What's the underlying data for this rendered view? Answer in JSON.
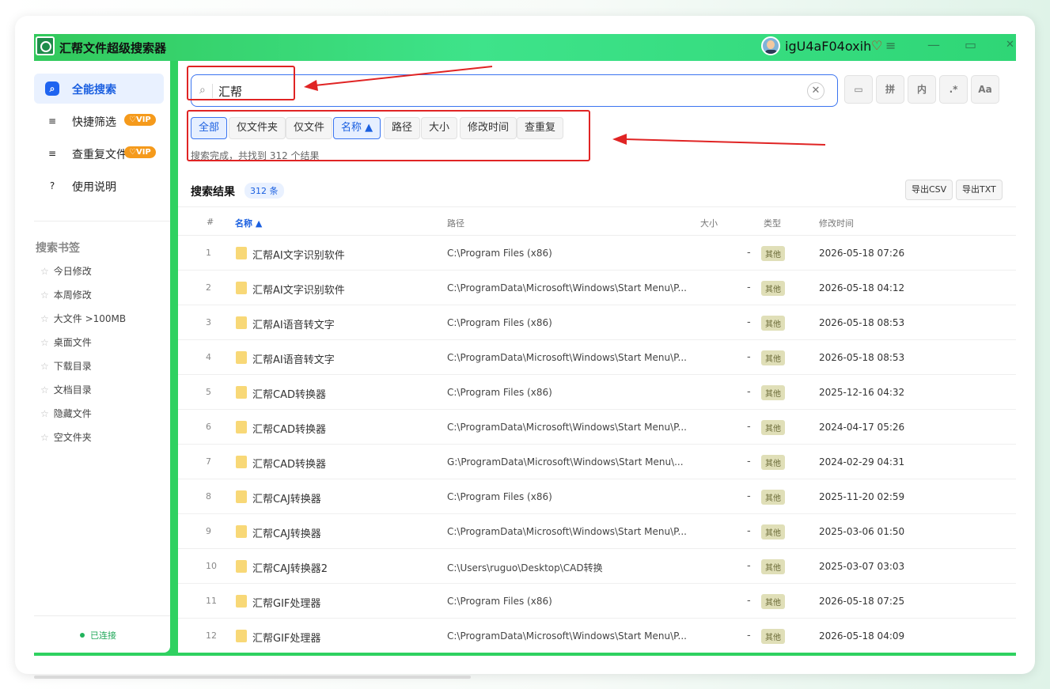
{
  "app": {
    "title": "汇帮文件超级搜索器",
    "username": "igU4aF04oxih",
    "heart": "♡",
    "menu": "≡",
    "minimize": "—",
    "maximize": "▭",
    "close": "✕"
  },
  "sidebar": {
    "nav": [
      {
        "icon": "⌕",
        "label": "全能搜索",
        "vip": ""
      },
      {
        "icon": "≡",
        "label": "快捷筛选",
        "vip": "♡VIP"
      },
      {
        "icon": "≡",
        "label": "查重复文件",
        "vip": "♡VIP"
      },
      {
        "icon": "?",
        "label": "使用说明",
        "vip": ""
      }
    ],
    "bookmarks_title": "搜索书签",
    "bookmarks": [
      "今日修改",
      "本周修改",
      "大文件 >100MB",
      "桌面文件",
      "下载目录",
      "文档目录",
      "隐藏文件",
      "空文件夹"
    ],
    "status": "已连接"
  },
  "search": {
    "icon": "⌕",
    "value": "汇帮",
    "clear": "✕"
  },
  "tools": [
    "▭",
    "拼",
    "内",
    ".*",
    "Aa"
  ],
  "filters": [
    "全部",
    "仅文件夹",
    "仅文件",
    "名称 ▲",
    "路径",
    "大小",
    "修改时间",
    "查重复"
  ],
  "status_text": "搜索完成，共找到 312 个结果",
  "results": {
    "title": "搜索结果",
    "count": "312 条",
    "export_csv": "导出CSV",
    "export_txt": "导出TXT",
    "columns": {
      "num": "#",
      "name": "名称 ▲",
      "path": "路径",
      "size": "大小",
      "type": "类型",
      "mtime": "修改时间"
    },
    "rows": [
      {
        "num": "1",
        "name": "汇帮AI文字识别软件",
        "path": "C:\\Program Files (x86)",
        "size": "-",
        "type": "其他",
        "mtime": "2026-05-18 07:26"
      },
      {
        "num": "2",
        "name": "汇帮AI文字识别软件",
        "path": "C:\\ProgramData\\Microsoft\\Windows\\Start Menu\\P...",
        "size": "-",
        "type": "其他",
        "mtime": "2026-05-18 04:12"
      },
      {
        "num": "3",
        "name": "汇帮AI语音转文字",
        "path": "C:\\Program Files (x86)",
        "size": "-",
        "type": "其他",
        "mtime": "2026-05-18 08:53"
      },
      {
        "num": "4",
        "name": "汇帮AI语音转文字",
        "path": "C:\\ProgramData\\Microsoft\\Windows\\Start Menu\\P...",
        "size": "-",
        "type": "其他",
        "mtime": "2026-05-18 08:53"
      },
      {
        "num": "5",
        "name": "汇帮CAD转换器",
        "path": "C:\\Program Files (x86)",
        "size": "-",
        "type": "其他",
        "mtime": "2025-12-16 04:32"
      },
      {
        "num": "6",
        "name": "汇帮CAD转换器",
        "path": "C:\\ProgramData\\Microsoft\\Windows\\Start Menu\\P...",
        "size": "-",
        "type": "其他",
        "mtime": "2024-04-17 05:26"
      },
      {
        "num": "7",
        "name": "汇帮CAD转换器",
        "path": "G:\\ProgramData\\Microsoft\\Windows\\Start Menu\\...",
        "size": "-",
        "type": "其他",
        "mtime": "2024-02-29 04:31"
      },
      {
        "num": "8",
        "name": "汇帮CAJ转换器",
        "path": "C:\\Program Files (x86)",
        "size": "-",
        "type": "其他",
        "mtime": "2025-11-20 02:59"
      },
      {
        "num": "9",
        "name": "汇帮CAJ转换器",
        "path": "C:\\ProgramData\\Microsoft\\Windows\\Start Menu\\P...",
        "size": "-",
        "type": "其他",
        "mtime": "2025-03-06 01:50"
      },
      {
        "num": "10",
        "name": "汇帮CAJ转换器2",
        "path": "C:\\Users\\ruguo\\Desktop\\CAD转换",
        "size": "-",
        "type": "其他",
        "mtime": "2025-03-07 03:03"
      },
      {
        "num": "11",
        "name": "汇帮GIF处理器",
        "path": "C:\\Program Files (x86)",
        "size": "-",
        "type": "其他",
        "mtime": "2026-05-18 07:25"
      },
      {
        "num": "12",
        "name": "汇帮GIF处理器",
        "path": "C:\\ProgramData\\Microsoft\\Windows\\Start Menu\\P...",
        "size": "-",
        "type": "其他",
        "mtime": "2026-05-18 04:09"
      }
    ]
  },
  "colors": {
    "accent": "#1f64f0",
    "titlebar": "#3ee38a",
    "annotation": "#e02424",
    "vip": "#f59a1b"
  }
}
